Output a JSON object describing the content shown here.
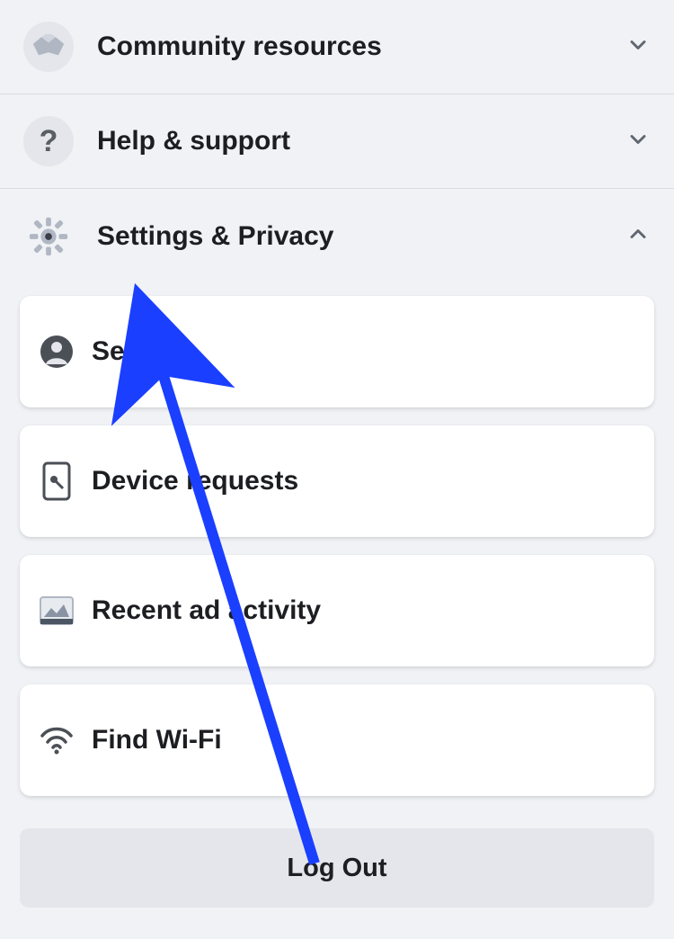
{
  "menu": {
    "community": {
      "label": "Community resources",
      "expanded": false
    },
    "help": {
      "label": "Help & support",
      "expanded": false
    },
    "settings_privacy": {
      "label": "Settings & Privacy",
      "expanded": true
    }
  },
  "submenu": {
    "settings": {
      "label": "Settings"
    },
    "device_requests": {
      "label": "Device requests"
    },
    "recent_ad_activity": {
      "label": "Recent ad activity"
    },
    "find_wifi": {
      "label": "Find Wi-Fi"
    }
  },
  "logout_label": "Log Out",
  "colors": {
    "page_bg": "#f0f2f5",
    "card_bg": "#ffffff",
    "icon_bg": "#e4e6eb",
    "text": "#1c1e21",
    "annotation_arrow": "#1a3fff"
  }
}
